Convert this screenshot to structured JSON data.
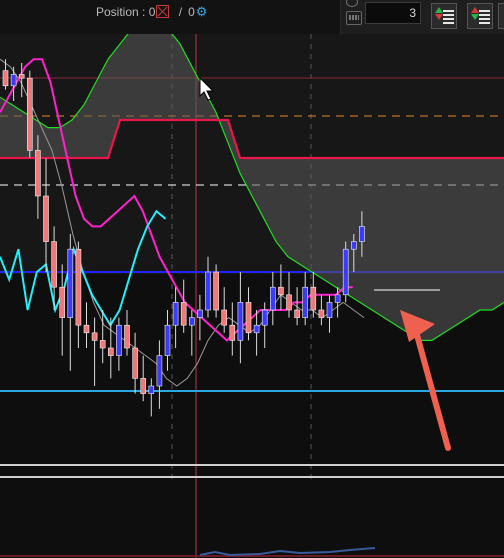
{
  "header": {
    "position_label": "Position : 0",
    "position_sep": "/",
    "position_value_2": "0",
    "quantity_value": "3"
  },
  "colors": {
    "background": "#0e0e0e",
    "bull_candle": "#3b3bff",
    "bear_candle": "#f07878",
    "kumo_lead_a": "#22dd22",
    "kumo_lead_b": "#e8174a",
    "kijun": "#ff22cc",
    "tenkan": "#22f0f8",
    "chikou": "#9a9a9a",
    "blue_level": "#2222ff",
    "cyan_level": "#2aa8e0",
    "annotation_arrow": "#f0604e"
  },
  "chart_data": {
    "type": "candlestick",
    "title": "",
    "xlabel": "",
    "ylabel": "",
    "ylim": [
      0,
      100
    ],
    "grid": true,
    "candles": [
      {
        "o": 93,
        "h": 96,
        "l": 88,
        "c": 89
      },
      {
        "o": 89,
        "h": 94,
        "l": 85,
        "c": 92
      },
      {
        "o": 92,
        "h": 95,
        "l": 86,
        "c": 91
      },
      {
        "o": 91,
        "h": 93,
        "l": 70,
        "c": 72
      },
      {
        "o": 72,
        "h": 76,
        "l": 54,
        "c": 60
      },
      {
        "o": 60,
        "h": 70,
        "l": 40,
        "c": 48
      },
      {
        "o": 48,
        "h": 52,
        "l": 30,
        "c": 36
      },
      {
        "o": 36,
        "h": 42,
        "l": 18,
        "c": 28
      },
      {
        "o": 28,
        "h": 50,
        "l": 14,
        "c": 46
      },
      {
        "o": 46,
        "h": 48,
        "l": 20,
        "c": 26
      },
      {
        "o": 26,
        "h": 32,
        "l": 20,
        "c": 24
      },
      {
        "o": 24,
        "h": 28,
        "l": 10,
        "c": 22
      },
      {
        "o": 22,
        "h": 30,
        "l": 16,
        "c": 20
      },
      {
        "o": 20,
        "h": 28,
        "l": 12,
        "c": 18
      },
      {
        "o": 18,
        "h": 28,
        "l": 14,
        "c": 26
      },
      {
        "o": 26,
        "h": 30,
        "l": 18,
        "c": 20
      },
      {
        "o": 20,
        "h": 24,
        "l": 8,
        "c": 12
      },
      {
        "o": 12,
        "h": 18,
        "l": 6,
        "c": 8
      },
      {
        "o": 8,
        "h": 12,
        "l": 2,
        "c": 10
      },
      {
        "o": 10,
        "h": 22,
        "l": 4,
        "c": 18
      },
      {
        "o": 18,
        "h": 30,
        "l": 14,
        "c": 26
      },
      {
        "o": 26,
        "h": 36,
        "l": 20,
        "c": 32
      },
      {
        "o": 32,
        "h": 38,
        "l": 24,
        "c": 26
      },
      {
        "o": 26,
        "h": 30,
        "l": 18,
        "c": 28
      },
      {
        "o": 28,
        "h": 34,
        "l": 22,
        "c": 30
      },
      {
        "o": 30,
        "h": 44,
        "l": 28,
        "c": 40
      },
      {
        "o": 40,
        "h": 42,
        "l": 28,
        "c": 30
      },
      {
        "o": 30,
        "h": 36,
        "l": 24,
        "c": 26
      },
      {
        "o": 26,
        "h": 32,
        "l": 18,
        "c": 22
      },
      {
        "o": 22,
        "h": 40,
        "l": 16,
        "c": 32
      },
      {
        "o": 32,
        "h": 36,
        "l": 22,
        "c": 24
      },
      {
        "o": 24,
        "h": 30,
        "l": 18,
        "c": 26
      },
      {
        "o": 26,
        "h": 32,
        "l": 20,
        "c": 30
      },
      {
        "o": 30,
        "h": 40,
        "l": 26,
        "c": 36
      },
      {
        "o": 36,
        "h": 42,
        "l": 30,
        "c": 34
      },
      {
        "o": 34,
        "h": 40,
        "l": 28,
        "c": 30
      },
      {
        "o": 30,
        "h": 36,
        "l": 26,
        "c": 28
      },
      {
        "o": 28,
        "h": 40,
        "l": 26,
        "c": 36
      },
      {
        "o": 36,
        "h": 40,
        "l": 28,
        "c": 30
      },
      {
        "o": 30,
        "h": 34,
        "l": 26,
        "c": 28
      },
      {
        "o": 28,
        "h": 34,
        "l": 24,
        "c": 32
      },
      {
        "o": 32,
        "h": 36,
        "l": 28,
        "c": 34
      },
      {
        "o": 34,
        "h": 48,
        "l": 32,
        "c": 46
      },
      {
        "o": 46,
        "h": 50,
        "l": 40,
        "c": 48
      },
      {
        "o": 48,
        "h": 56,
        "l": 44,
        "c": 52
      }
    ],
    "lead_a": [
      86,
      84,
      82,
      80,
      78,
      78,
      80,
      84,
      90,
      96,
      100,
      104,
      104,
      106,
      104,
      100,
      94,
      88,
      82,
      74,
      66,
      60,
      54,
      48,
      44,
      42,
      40,
      38,
      36,
      34,
      32,
      30,
      28,
      26,
      24,
      22,
      22,
      24,
      26,
      28,
      30,
      30,
      32
    ],
    "lead_b": [
      70,
      70,
      70,
      70,
      70,
      70,
      70,
      70,
      70,
      70,
      80,
      80,
      80,
      80,
      80,
      80,
      80,
      80,
      80,
      80,
      70,
      70,
      70,
      70,
      70,
      70,
      70,
      70,
      70,
      70,
      70,
      70,
      70,
      70,
      70,
      70,
      70,
      70,
      70,
      70,
      70,
      70,
      70
    ],
    "kijun": [
      82,
      86,
      90,
      94,
      96,
      96,
      90,
      80,
      70,
      60,
      54,
      52,
      52,
      54,
      56,
      58,
      60,
      56,
      50,
      44,
      40,
      36,
      32,
      30,
      28,
      26,
      24,
      22,
      24,
      26,
      28,
      30,
      30,
      30,
      30,
      32,
      32,
      34,
      34,
      34,
      34,
      36,
      36
    ],
    "tenkan": [
      44,
      38,
      46,
      30,
      40,
      42,
      30,
      36,
      46,
      40,
      34,
      30,
      26,
      30,
      38,
      46,
      52,
      56,
      54
    ],
    "chikou": [
      96,
      94,
      90,
      84,
      78,
      72,
      62,
      50,
      40,
      32,
      26,
      24,
      22,
      20,
      18,
      16,
      12,
      10,
      12,
      16,
      22,
      26,
      28,
      26,
      24,
      26,
      30,
      34,
      32,
      30,
      30,
      28,
      30,
      32,
      30,
      28
    ]
  }
}
